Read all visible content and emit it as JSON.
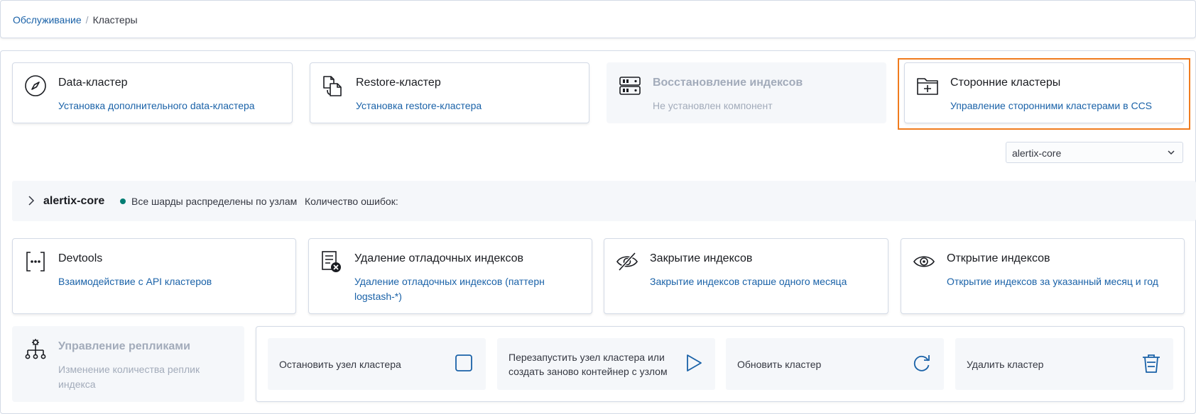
{
  "breadcrumb": {
    "parent": "Обслуживание",
    "separator": "/",
    "current": "Кластеры"
  },
  "top_cards": [
    {
      "title": "Data-кластер",
      "subtitle": "Установка дополнительного data-кластера",
      "icon": "compass-icon",
      "disabled": false
    },
    {
      "title": "Restore-кластер",
      "subtitle": "Установка restore-кластера",
      "icon": "copy-documents-icon",
      "disabled": false
    },
    {
      "title": "Восстановление индексов",
      "subtitle": "Не установлен компонент",
      "icon": "server-icon",
      "disabled": true
    },
    {
      "title": "Сторонние кластеры",
      "subtitle": "Управление сторонними кластерами в CCS",
      "icon": "folder-plus-icon",
      "disabled": false,
      "highlighted": true
    }
  ],
  "cluster_select": {
    "value": "alertix-core"
  },
  "status": {
    "cluster_name": "alertix-core",
    "shards_text": "Все шарды распределены по узлам",
    "errors_label": "Количество ошибок:",
    "status_color": "#017d73"
  },
  "tool_cards": [
    {
      "title": "Devtools",
      "subtitle": "Взаимодействие с API кластеров",
      "icon": "console-icon"
    },
    {
      "title": "Удаление отладочных индексов",
      "subtitle": "Удаление отладочных индексов (паттерн logstash-*)",
      "icon": "list-delete-icon"
    },
    {
      "title": "Закрытие индексов",
      "subtitle": "Закрытие индексов старше одного месяца",
      "icon": "eye-closed-icon"
    },
    {
      "title": "Открытие индексов",
      "subtitle": "Открытие индексов за указанный месяц и год",
      "icon": "eye-icon"
    }
  ],
  "replicas_card": {
    "title": "Управление репликами",
    "subtitle": "Изменение количества реплик индекса",
    "icon": "hierarchy-gear-icon",
    "disabled": true
  },
  "node_actions": [
    {
      "label": "Остановить узел кластера",
      "icon": "stop-icon"
    },
    {
      "label": "Перезапустить узел кластера или создать заново контейнер с узлом",
      "icon": "play-icon"
    },
    {
      "label": "Обновить кластер",
      "icon": "refresh-icon"
    },
    {
      "label": "Удалить кластер",
      "icon": "trash-icon"
    }
  ],
  "colors": {
    "link": "#1a62a8",
    "highlight": "#f07b1e",
    "action_icon": "#1a62a8"
  }
}
